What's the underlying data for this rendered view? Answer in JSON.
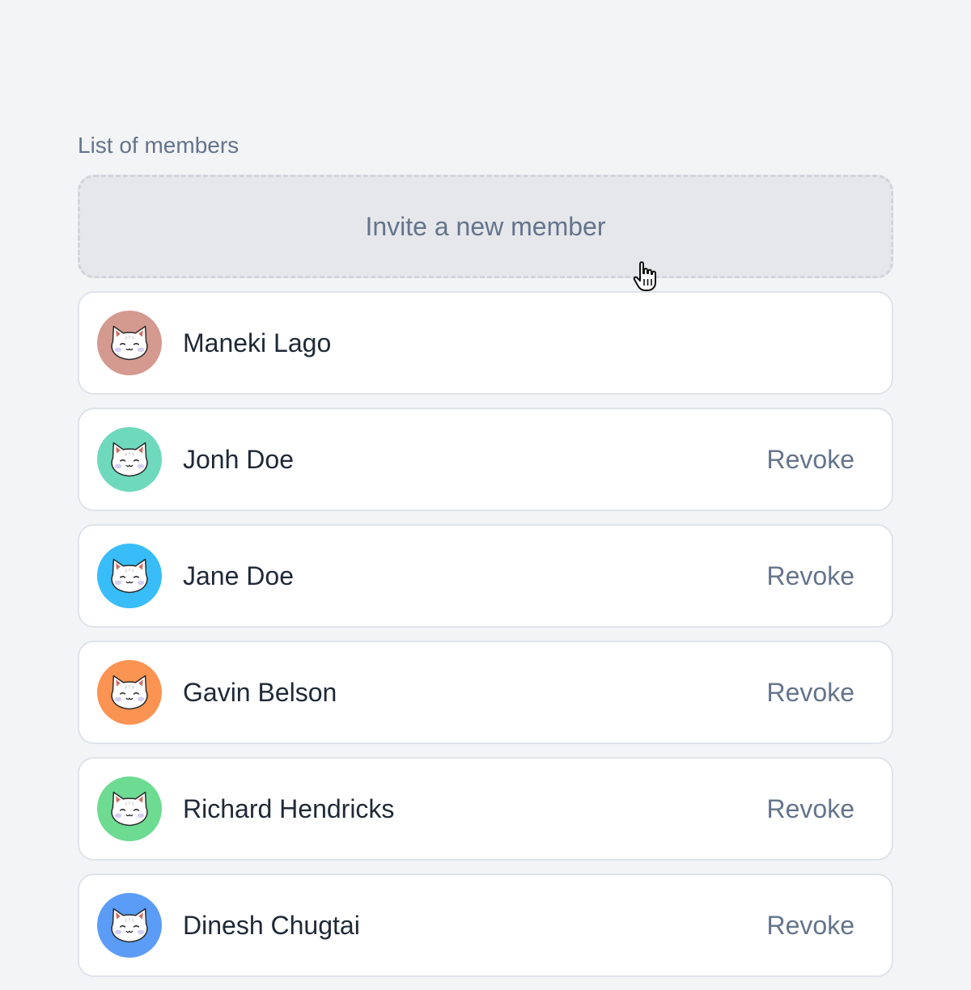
{
  "section_label": "List of members",
  "invite_label": "Invite a new member",
  "members": [
    {
      "name": "Maneki Lago",
      "avatar_color": "#d4998f",
      "revoke_label": ""
    },
    {
      "name": "Jonh Doe",
      "avatar_color": "#6ed9bd",
      "revoke_label": "Revoke"
    },
    {
      "name": "Jane Doe",
      "avatar_color": "#38bdf8",
      "revoke_label": "Revoke"
    },
    {
      "name": "Gavin Belson",
      "avatar_color": "#fb9452",
      "revoke_label": "Revoke"
    },
    {
      "name": "Richard Hendricks",
      "avatar_color": "#6ddb92",
      "revoke_label": "Revoke"
    },
    {
      "name": "Dinesh Chugtai",
      "avatar_color": "#5b9cf6",
      "revoke_label": "Revoke"
    }
  ],
  "icons": {
    "avatar": "cat-face-icon",
    "cursor": "pointer-hand-icon"
  }
}
